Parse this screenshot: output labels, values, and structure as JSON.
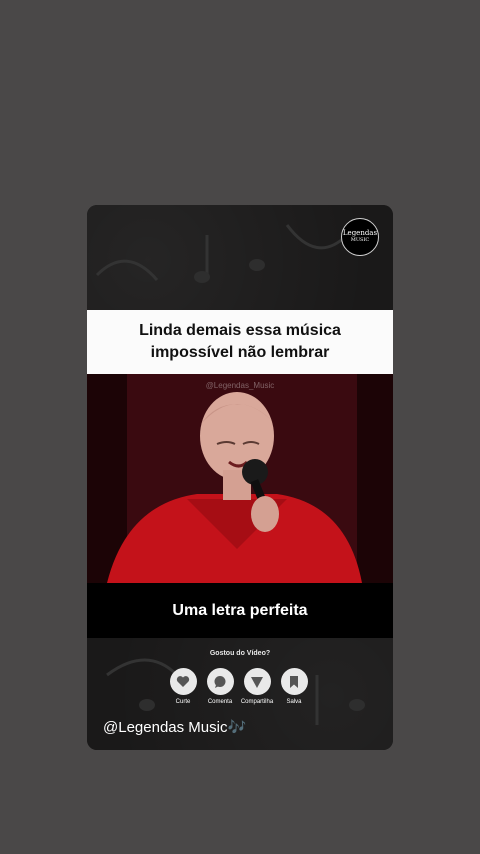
{
  "logo": {
    "line1": "Legendas",
    "line2": "MUSIC"
  },
  "caption_top": {
    "line1": "Linda demais essa música",
    "line2": "impossível não lembrar"
  },
  "video": {
    "watermark": "@Legendas_Music"
  },
  "caption_bottom": "Uma letra perfeita",
  "engagement": {
    "question": "Gostou do Vídeo?",
    "actions": [
      {
        "label": "Curte",
        "icon": "heart-icon"
      },
      {
        "label": "Comenta",
        "icon": "comment-icon"
      },
      {
        "label": "Compartilha",
        "icon": "share-icon"
      },
      {
        "label": "Salva",
        "icon": "bookmark-icon"
      }
    ]
  },
  "handle": "@Legendas Music🎶",
  "colors": {
    "background": "#4a4848",
    "caption_bg": "#fbfbfb",
    "jacket_red": "#c4121a"
  }
}
